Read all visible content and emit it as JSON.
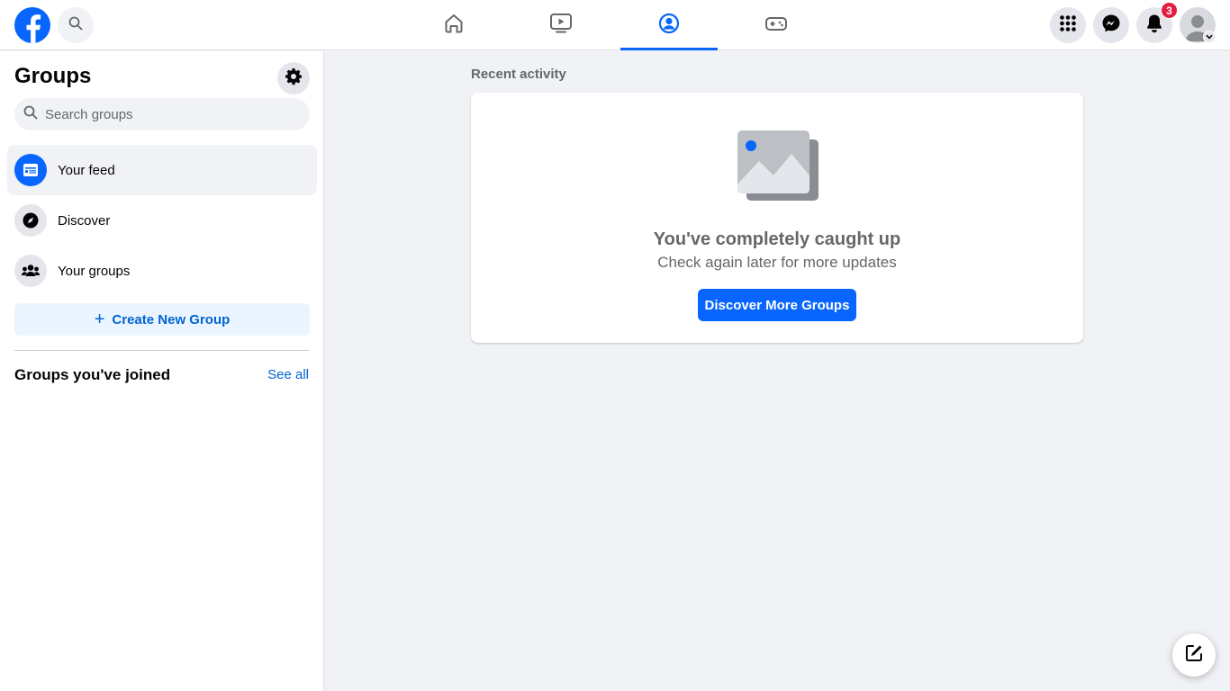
{
  "colors": {
    "brand": "#0866ff",
    "link": "#0064d1",
    "badge": "#e41e3f",
    "background": "#f0f2f5",
    "muted_text": "#65676b"
  },
  "topbar": {
    "logo_icon": "facebook-logo",
    "search_icon": "search-icon",
    "tabs": [
      {
        "name": "home",
        "icon": "home-icon",
        "active": false
      },
      {
        "name": "video",
        "icon": "video-icon",
        "active": false
      },
      {
        "name": "groups",
        "icon": "groups-icon",
        "active": true
      },
      {
        "name": "gaming",
        "icon": "gaming-icon",
        "active": false
      }
    ],
    "notifications_count": "3"
  },
  "sidebar": {
    "title": "Groups",
    "search_placeholder": "Search groups",
    "items": [
      {
        "label": "Your feed",
        "icon": "feed-icon",
        "active": true
      },
      {
        "label": "Discover",
        "icon": "compass-icon",
        "active": false
      },
      {
        "label": "Your groups",
        "icon": "people-icon",
        "active": false
      }
    ],
    "create_label": "Create New Group",
    "joined_title": "Groups you've joined",
    "see_all_label": "See all"
  },
  "main": {
    "section_label": "Recent activity",
    "empty_title": "You've completely caught up",
    "empty_subtitle": "Check again later for more updates",
    "discover_button": "Discover More Groups"
  }
}
